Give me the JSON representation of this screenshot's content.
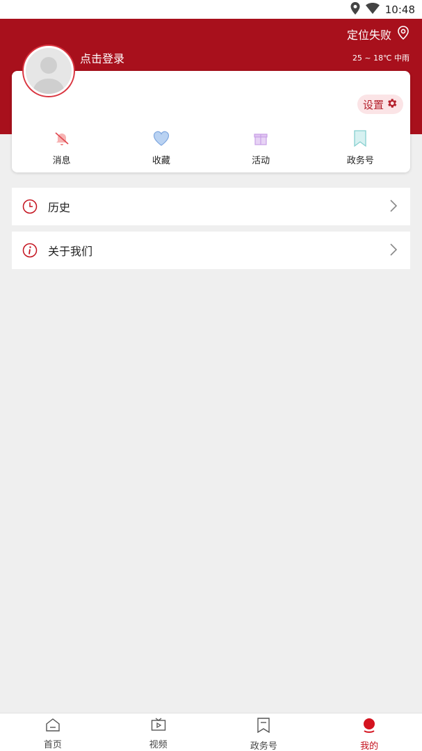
{
  "status_bar": {
    "time": "10:48",
    "icons": [
      "location-pin-icon",
      "wifi-icon"
    ]
  },
  "header": {
    "location_text": "定位失败",
    "weather": "25 ~ 18℃ 中雨",
    "login_text": "点击登录"
  },
  "card": {
    "settings_label": "设置",
    "quick_items": [
      {
        "label": "消息",
        "icon": "bell-mute-icon"
      },
      {
        "label": "收藏",
        "icon": "heart-icon"
      },
      {
        "label": "活动",
        "icon": "gift-icon"
      },
      {
        "label": "政务号",
        "icon": "bookmark-icon"
      }
    ]
  },
  "menu": [
    {
      "label": "历史",
      "icon": "clock-icon"
    },
    {
      "label": "关于我们",
      "icon": "info-icon"
    }
  ],
  "tabbar": [
    {
      "label": "首页",
      "icon": "home-icon",
      "active": false
    },
    {
      "label": "视频",
      "icon": "tv-icon",
      "active": false
    },
    {
      "label": "政务号",
      "icon": "bookmark-icon",
      "active": false
    },
    {
      "label": "我的",
      "icon": "profile-icon",
      "active": true
    }
  ],
  "colors": {
    "brand": "#a8101c",
    "active_tab": "#c4121e",
    "background": "#efefef"
  }
}
